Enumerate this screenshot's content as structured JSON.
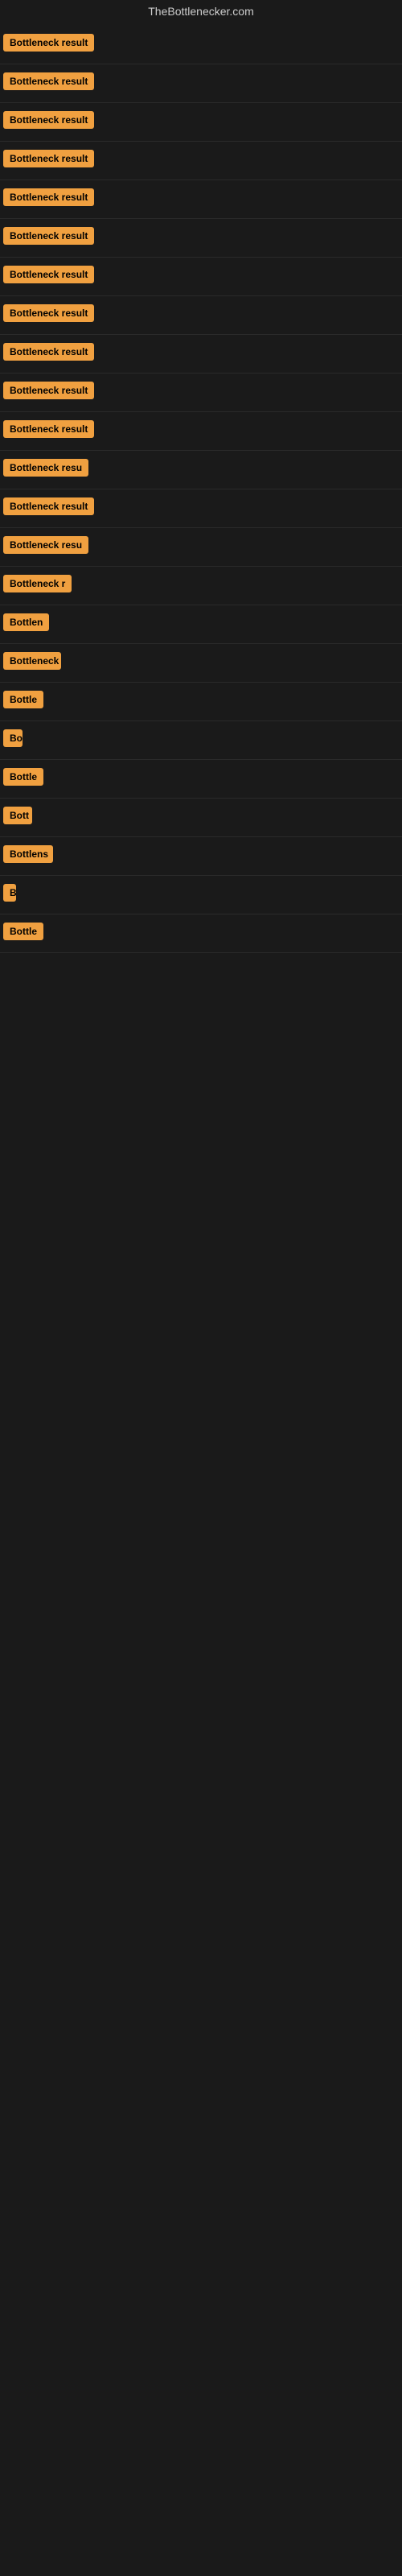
{
  "site": {
    "title": "TheBottlenecker.com"
  },
  "results": [
    {
      "label": "Bottleneck result",
      "width": 120
    },
    {
      "label": "Bottleneck result",
      "width": 120
    },
    {
      "label": "Bottleneck result",
      "width": 120
    },
    {
      "label": "Bottleneck result",
      "width": 120
    },
    {
      "label": "Bottleneck result",
      "width": 120
    },
    {
      "label": "Bottleneck result",
      "width": 120
    },
    {
      "label": "Bottleneck result",
      "width": 120
    },
    {
      "label": "Bottleneck result",
      "width": 120
    },
    {
      "label": "Bottleneck result",
      "width": 120
    },
    {
      "label": "Bottleneck result",
      "width": 120
    },
    {
      "label": "Bottleneck result",
      "width": 120
    },
    {
      "label": "Bottleneck resu",
      "width": 110
    },
    {
      "label": "Bottleneck result",
      "width": 118
    },
    {
      "label": "Bottleneck resu",
      "width": 108
    },
    {
      "label": "Bottleneck r",
      "width": 88
    },
    {
      "label": "Bottlen",
      "width": 60
    },
    {
      "label": "Bottleneck",
      "width": 72
    },
    {
      "label": "Bottle",
      "width": 50
    },
    {
      "label": "Bo",
      "width": 24
    },
    {
      "label": "Bottle",
      "width": 50
    },
    {
      "label": "Bott",
      "width": 36
    },
    {
      "label": "Bottlens",
      "width": 62
    },
    {
      "label": "B",
      "width": 14
    },
    {
      "label": "Bottle",
      "width": 50
    }
  ]
}
